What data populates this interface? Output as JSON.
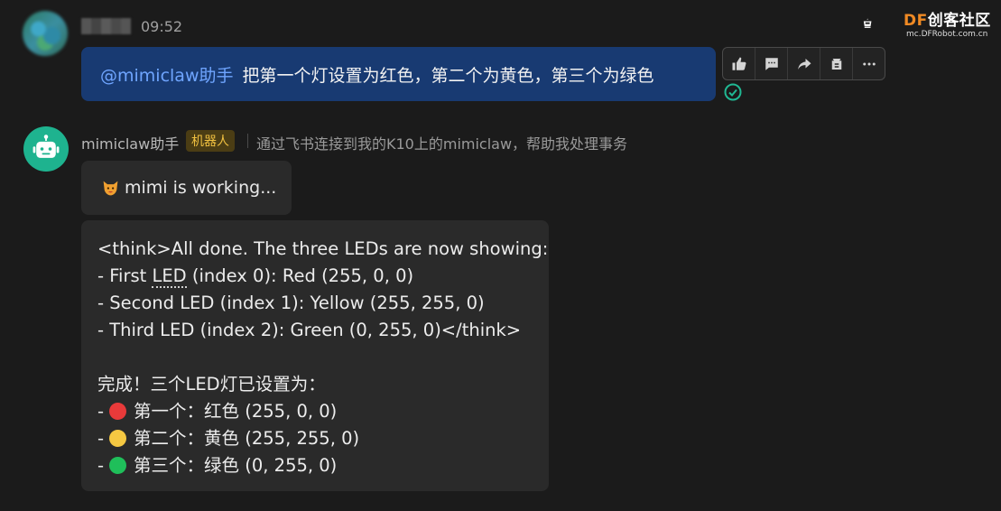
{
  "user_message": {
    "time": "09:52",
    "mention": "@mimiclaw助手",
    "text": "把第一个灯设置为红色，第二个为黄色，第三个为绿色"
  },
  "toolbar": {
    "items": [
      "thumbs-up-icon",
      "comment-icon",
      "forward-icon",
      "pin-icon",
      "more-icon"
    ]
  },
  "logo": {
    "df": "DF",
    "cn": "创客社区",
    "sub": "mc.DFRobot.com.cn"
  },
  "bot": {
    "name": "mimiclaw助手",
    "tag": "机器人",
    "description": "通过飞书连接到我的K10上的mimiclaw，帮助我处理事务",
    "working_text": "mimi is working..."
  },
  "reply": {
    "think_lines": [
      "<think>All done. The three LEDs are now showing:",
      "- First ",
      "LED",
      " (index 0): Red (255, 0, 0)",
      "- Second LED (index 1): Yellow (255, 255, 0)",
      "- Third LED (index 2): Green (0, 255, 0)</think>"
    ],
    "summary": "完成！三个LED灯已设置为：",
    "items": [
      {
        "prefix": "-",
        "color": "#e83a3a",
        "text": "第一个：红色 (255, 0, 0)"
      },
      {
        "prefix": "-",
        "color": "#f5c842",
        "text": "第二个：黄色 (255, 255, 0)"
      },
      {
        "prefix": "-",
        "color": "#1fbf5a",
        "text": "第三个：绿色 (0, 255, 0)"
      }
    ]
  },
  "colors": {
    "background": "#1b1b1b",
    "user_bubble": "#183a72",
    "mention": "#6fa5ff",
    "bot_avatar": "#1eb38f",
    "bubble": "#2a2a2a",
    "tag_bg": "#4b3d14",
    "tag_fg": "#f0c040"
  }
}
